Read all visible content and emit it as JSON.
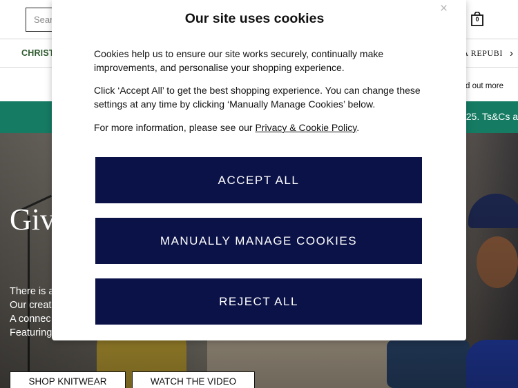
{
  "header": {
    "search_placeholder": "Search",
    "bag_count": "0"
  },
  "nav": {
    "left_item": "CHRIST",
    "right_item": "A REPUBI"
  },
  "info_strip": {
    "find_out_more": "d out more"
  },
  "promo": {
    "text": "25. Ts&Cs a"
  },
  "hero": {
    "title": "Giv",
    "lines": [
      "There is a",
      "Our creat",
      "A connec",
      "Featuring"
    ],
    "shop_button": "SHOP KNITWEAR",
    "watch_button": "WATCH THE VIDEO"
  },
  "cookie_modal": {
    "close_symbol": "×",
    "title": "Our site uses cookies",
    "para1": "Cookies help us to ensure our site works securely, continually make improvements, and personalise your shopping experience.",
    "para2": "Click ‘Accept All’ to get the best shopping experience. You can change these settings at any time by clicking ‘Manually Manage Cookies’ below.",
    "para3_prefix": "For more information, please see our ",
    "policy_link": "Privacy & Cookie Policy",
    "para3_suffix": ".",
    "accept_label": "ACCEPT ALL",
    "manage_label": "MANUALLY MANAGE COOKIES",
    "reject_label": "REJECT ALL"
  },
  "colors": {
    "button_navy": "#0b1247",
    "promo_green": "#157b63",
    "nav_green": "#2f5a2f"
  }
}
